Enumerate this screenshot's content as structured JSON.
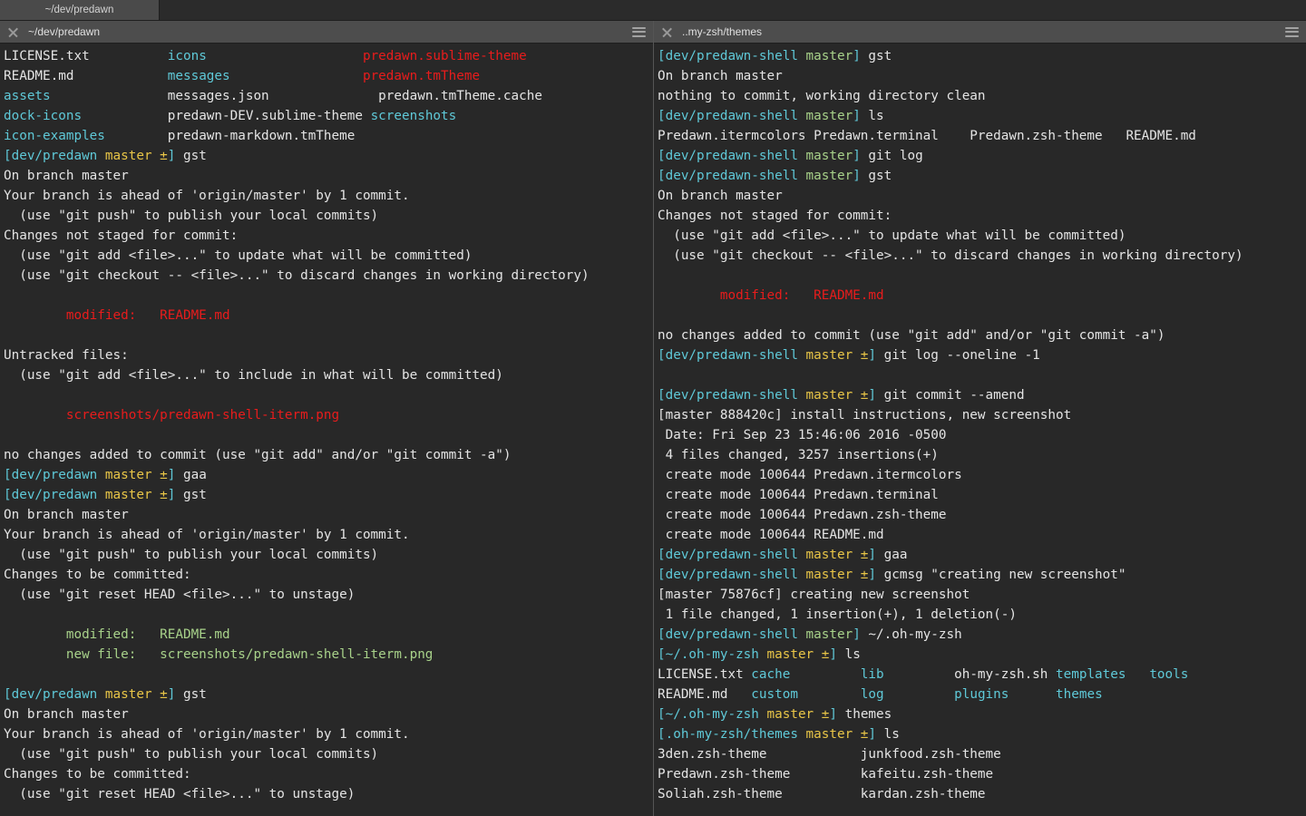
{
  "window": {
    "tabs": [
      {
        "label": "~/dev/predawn",
        "active": true
      }
    ]
  },
  "panes": [
    {
      "id": "left",
      "title": "~/dev/predawn",
      "close_icon": "close-icon",
      "menu_icon": "hamburger-menu-icon",
      "lines": [
        [
          {
            "t": "LICENSE.txt    ",
            "c": "white"
          },
          {
            "t": "      icons",
            "c": "cyan"
          },
          {
            "t": "                    ",
            "c": "white"
          },
          {
            "t": "predawn.sublime-theme",
            "c": "red"
          }
        ],
        [
          {
            "t": "README.md      ",
            "c": "white"
          },
          {
            "t": "      messages",
            "c": "cyan"
          },
          {
            "t": "                 ",
            "c": "white"
          },
          {
            "t": "predawn.tmTheme",
            "c": "red"
          }
        ],
        [
          {
            "t": "assets",
            "c": "cyan"
          },
          {
            "t": "               messages.json              predawn.tmTheme.cache",
            "c": "white"
          }
        ],
        [
          {
            "t": "dock-icons",
            "c": "cyan"
          },
          {
            "t": "           predawn-DEV.sublime-theme ",
            "c": "white"
          },
          {
            "t": "screenshots",
            "c": "cyan"
          }
        ],
        [
          {
            "t": "icon-examples",
            "c": "cyan"
          },
          {
            "t": "        predawn-markdown.tmTheme",
            "c": "white"
          }
        ],
        [
          {
            "t": "[",
            "c": "cyan"
          },
          {
            "t": "dev/predawn ",
            "c": "cyan"
          },
          {
            "t": "master ±",
            "c": "yellow"
          },
          {
            "t": "]",
            "c": "cyan"
          },
          {
            "t": " gst",
            "c": "white"
          }
        ],
        [
          {
            "t": "On branch master",
            "c": "white"
          }
        ],
        [
          {
            "t": "Your branch is ahead of 'origin/master' by 1 commit.",
            "c": "white"
          }
        ],
        [
          {
            "t": "  (use \"git push\" to publish your local commits)",
            "c": "white"
          }
        ],
        [
          {
            "t": "Changes not staged for commit:",
            "c": "white"
          }
        ],
        [
          {
            "t": "  (use \"git add <file>...\" to update what will be committed)",
            "c": "white"
          }
        ],
        [
          {
            "t": "  (use \"git checkout -- <file>...\" to discard changes in working directory)",
            "c": "white"
          }
        ],
        [
          {
            "t": "",
            "c": "white"
          }
        ],
        [
          {
            "t": "        modified:   README.md",
            "c": "red"
          }
        ],
        [
          {
            "t": "",
            "c": "white"
          }
        ],
        [
          {
            "t": "Untracked files:",
            "c": "white"
          }
        ],
        [
          {
            "t": "  (use \"git add <file>...\" to include in what will be committed)",
            "c": "white"
          }
        ],
        [
          {
            "t": "",
            "c": "white"
          }
        ],
        [
          {
            "t": "        screenshots/predawn-shell-iterm.png",
            "c": "red"
          }
        ],
        [
          {
            "t": "",
            "c": "white"
          }
        ],
        [
          {
            "t": "no changes added to commit (use \"git add\" and/or \"git commit -a\")",
            "c": "white"
          }
        ],
        [
          {
            "t": "[",
            "c": "cyan"
          },
          {
            "t": "dev/predawn ",
            "c": "cyan"
          },
          {
            "t": "master ±",
            "c": "yellow"
          },
          {
            "t": "]",
            "c": "cyan"
          },
          {
            "t": " gaa",
            "c": "white"
          }
        ],
        [
          {
            "t": "[",
            "c": "cyan"
          },
          {
            "t": "dev/predawn ",
            "c": "cyan"
          },
          {
            "t": "master ±",
            "c": "yellow"
          },
          {
            "t": "]",
            "c": "cyan"
          },
          {
            "t": " gst",
            "c": "white"
          }
        ],
        [
          {
            "t": "On branch master",
            "c": "white"
          }
        ],
        [
          {
            "t": "Your branch is ahead of 'origin/master' by 1 commit.",
            "c": "white"
          }
        ],
        [
          {
            "t": "  (use \"git push\" to publish your local commits)",
            "c": "white"
          }
        ],
        [
          {
            "t": "Changes to be committed:",
            "c": "white"
          }
        ],
        [
          {
            "t": "  (use \"git reset HEAD <file>...\" to unstage)",
            "c": "white"
          }
        ],
        [
          {
            "t": "",
            "c": "white"
          }
        ],
        [
          {
            "t": "        modified:   README.md",
            "c": "green"
          }
        ],
        [
          {
            "t": "        new file:   screenshots/predawn-shell-iterm.png",
            "c": "green"
          }
        ],
        [
          {
            "t": "",
            "c": "white"
          }
        ],
        [
          {
            "t": "[",
            "c": "cyan"
          },
          {
            "t": "dev/predawn ",
            "c": "cyan"
          },
          {
            "t": "master ±",
            "c": "yellow"
          },
          {
            "t": "]",
            "c": "cyan"
          },
          {
            "t": " gst",
            "c": "white"
          }
        ],
        [
          {
            "t": "On branch master",
            "c": "white"
          }
        ],
        [
          {
            "t": "Your branch is ahead of 'origin/master' by 1 commit.",
            "c": "white"
          }
        ],
        [
          {
            "t": "  (use \"git push\" to publish your local commits)",
            "c": "white"
          }
        ],
        [
          {
            "t": "Changes to be committed:",
            "c": "white"
          }
        ],
        [
          {
            "t": "  (use \"git reset HEAD <file>...\" to unstage)",
            "c": "white"
          }
        ]
      ]
    },
    {
      "id": "right",
      "title": "..my-zsh/themes",
      "close_icon": "close-icon",
      "menu_icon": "hamburger-menu-icon",
      "lines": [
        [
          {
            "t": "[",
            "c": "cyan"
          },
          {
            "t": "dev/predawn-shell ",
            "c": "cyan"
          },
          {
            "t": "master",
            "c": "green"
          },
          {
            "t": "]",
            "c": "cyan"
          },
          {
            "t": " gst",
            "c": "white"
          }
        ],
        [
          {
            "t": "On branch master",
            "c": "white"
          }
        ],
        [
          {
            "t": "nothing to commit, working directory clean",
            "c": "white"
          }
        ],
        [
          {
            "t": "[",
            "c": "cyan"
          },
          {
            "t": "dev/predawn-shell ",
            "c": "cyan"
          },
          {
            "t": "master",
            "c": "green"
          },
          {
            "t": "]",
            "c": "cyan"
          },
          {
            "t": " ls",
            "c": "white"
          }
        ],
        [
          {
            "t": "Predawn.itermcolors Predawn.terminal    Predawn.zsh-theme   README.md",
            "c": "white"
          }
        ],
        [
          {
            "t": "[",
            "c": "cyan"
          },
          {
            "t": "dev/predawn-shell ",
            "c": "cyan"
          },
          {
            "t": "master",
            "c": "green"
          },
          {
            "t": "]",
            "c": "cyan"
          },
          {
            "t": " git log",
            "c": "white"
          }
        ],
        [
          {
            "t": "[",
            "c": "cyan"
          },
          {
            "t": "dev/predawn-shell ",
            "c": "cyan"
          },
          {
            "t": "master",
            "c": "green"
          },
          {
            "t": "]",
            "c": "cyan"
          },
          {
            "t": " gst",
            "c": "white"
          }
        ],
        [
          {
            "t": "On branch master",
            "c": "white"
          }
        ],
        [
          {
            "t": "Changes not staged for commit:",
            "c": "white"
          }
        ],
        [
          {
            "t": "  (use \"git add <file>...\" to update what will be committed)",
            "c": "white"
          }
        ],
        [
          {
            "t": "  (use \"git checkout -- <file>...\" to discard changes in working directory)",
            "c": "white"
          }
        ],
        [
          {
            "t": "",
            "c": "white"
          }
        ],
        [
          {
            "t": "        modified:   README.md",
            "c": "red"
          }
        ],
        [
          {
            "t": "",
            "c": "white"
          }
        ],
        [
          {
            "t": "no changes added to commit (use \"git add\" and/or \"git commit -a\")",
            "c": "white"
          }
        ],
        [
          {
            "t": "[",
            "c": "cyan"
          },
          {
            "t": "dev/predawn-shell ",
            "c": "cyan"
          },
          {
            "t": "master ±",
            "c": "yellow"
          },
          {
            "t": "]",
            "c": "cyan"
          },
          {
            "t": " git log --oneline -1",
            "c": "white"
          }
        ],
        [
          {
            "t": "",
            "c": "white"
          }
        ],
        [
          {
            "t": "[",
            "c": "cyan"
          },
          {
            "t": "dev/predawn-shell ",
            "c": "cyan"
          },
          {
            "t": "master ±",
            "c": "yellow"
          },
          {
            "t": "]",
            "c": "cyan"
          },
          {
            "t": " git commit --amend",
            "c": "white"
          }
        ],
        [
          {
            "t": "[master 888420c] install instructions, new screenshot",
            "c": "white"
          }
        ],
        [
          {
            "t": " Date: Fri Sep 23 15:46:06 2016 -0500",
            "c": "white"
          }
        ],
        [
          {
            "t": " 4 files changed, 3257 insertions(+)",
            "c": "white"
          }
        ],
        [
          {
            "t": " create mode 100644 Predawn.itermcolors",
            "c": "white"
          }
        ],
        [
          {
            "t": " create mode 100644 Predawn.terminal",
            "c": "white"
          }
        ],
        [
          {
            "t": " create mode 100644 Predawn.zsh-theme",
            "c": "white"
          }
        ],
        [
          {
            "t": " create mode 100644 README.md",
            "c": "white"
          }
        ],
        [
          {
            "t": "[",
            "c": "cyan"
          },
          {
            "t": "dev/predawn-shell ",
            "c": "cyan"
          },
          {
            "t": "master ±",
            "c": "yellow"
          },
          {
            "t": "]",
            "c": "cyan"
          },
          {
            "t": " gaa",
            "c": "white"
          }
        ],
        [
          {
            "t": "[",
            "c": "cyan"
          },
          {
            "t": "dev/predawn-shell ",
            "c": "cyan"
          },
          {
            "t": "master ±",
            "c": "yellow"
          },
          {
            "t": "]",
            "c": "cyan"
          },
          {
            "t": " gcmsg \"creating new screenshot\"",
            "c": "white"
          }
        ],
        [
          {
            "t": "[master 75876cf] creating new screenshot",
            "c": "white"
          }
        ],
        [
          {
            "t": " 1 file changed, 1 insertion(+), 1 deletion(-)",
            "c": "white"
          }
        ],
        [
          {
            "t": "[",
            "c": "cyan"
          },
          {
            "t": "dev/predawn-shell ",
            "c": "cyan"
          },
          {
            "t": "master",
            "c": "green"
          },
          {
            "t": "]",
            "c": "cyan"
          },
          {
            "t": " ~/.oh-my-zsh",
            "c": "white"
          }
        ],
        [
          {
            "t": "[",
            "c": "cyan"
          },
          {
            "t": "~/.oh-my-zsh ",
            "c": "cyan"
          },
          {
            "t": "master ±",
            "c": "yellow"
          },
          {
            "t": "]",
            "c": "cyan"
          },
          {
            "t": " ls",
            "c": "white"
          }
        ],
        [
          {
            "t": "LICENSE.txt ",
            "c": "white"
          },
          {
            "t": "cache",
            "c": "cyan"
          },
          {
            "t": "         ",
            "c": "white"
          },
          {
            "t": "lib",
            "c": "cyan"
          },
          {
            "t": "         ",
            "c": "white"
          },
          {
            "t": "oh-my-zsh.sh ",
            "c": "white"
          },
          {
            "t": "templates",
            "c": "cyan"
          },
          {
            "t": "   ",
            "c": "white"
          },
          {
            "t": "tools",
            "c": "cyan"
          }
        ],
        [
          {
            "t": "README.md   ",
            "c": "white"
          },
          {
            "t": "custom",
            "c": "cyan"
          },
          {
            "t": "        ",
            "c": "white"
          },
          {
            "t": "log",
            "c": "cyan"
          },
          {
            "t": "         ",
            "c": "white"
          },
          {
            "t": "plugins",
            "c": "cyan"
          },
          {
            "t": "      ",
            "c": "white"
          },
          {
            "t": "themes",
            "c": "cyan"
          }
        ],
        [
          {
            "t": "[",
            "c": "cyan"
          },
          {
            "t": "~/.oh-my-zsh ",
            "c": "cyan"
          },
          {
            "t": "master ±",
            "c": "yellow"
          },
          {
            "t": "]",
            "c": "cyan"
          },
          {
            "t": " themes",
            "c": "white"
          }
        ],
        [
          {
            "t": "[",
            "c": "cyan"
          },
          {
            "t": ".oh-my-zsh/themes ",
            "c": "cyan"
          },
          {
            "t": "master ±",
            "c": "yellow"
          },
          {
            "t": "]",
            "c": "cyan"
          },
          {
            "t": " ls",
            "c": "white"
          }
        ],
        [
          {
            "t": "3den.zsh-theme            junkfood.zsh-theme",
            "c": "white"
          }
        ],
        [
          {
            "t": "Predawn.zsh-theme         kafeitu.zsh-theme",
            "c": "white"
          }
        ],
        [
          {
            "t": "Soliah.zsh-theme          kardan.zsh-theme",
            "c": "white"
          }
        ]
      ]
    }
  ],
  "colors": {
    "background": "#282828",
    "foreground": "#e4e4e4",
    "cyan": "#5fc9d8",
    "red": "#e81c1c",
    "green": "#a8d28a",
    "yellow": "#e8c547",
    "chrome": "#4d4d4d",
    "tab_active": "#4a4a4a"
  }
}
